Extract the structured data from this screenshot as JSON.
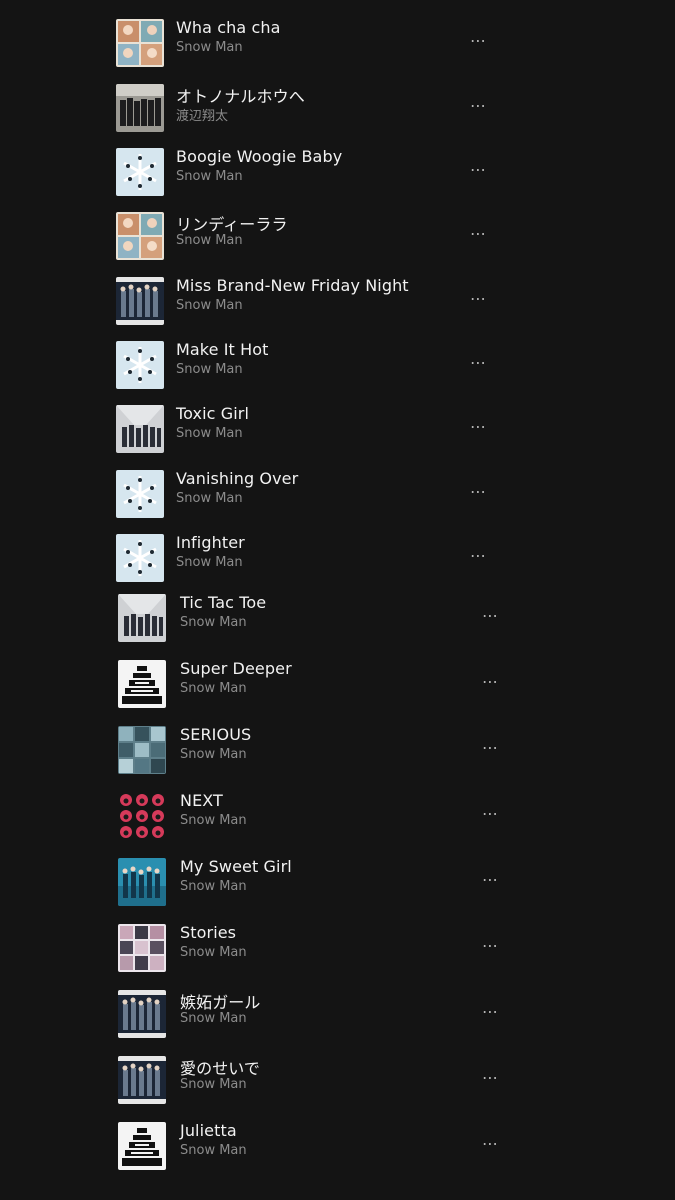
{
  "tracks": [
    {
      "title": "Wha cha cha",
      "artist": "Snow Man",
      "cover": "photo-warm"
    },
    {
      "title": "オトノナルホウへ",
      "artist": "渡辺翔太",
      "cover": "group-dark"
    },
    {
      "title": "Boogie Woogie Baby",
      "artist": "Snow Man",
      "cover": "ice-crystal"
    },
    {
      "title": "リンディーララ",
      "artist": "Snow Man",
      "cover": "photo-warm"
    },
    {
      "title": "Miss Brand-New Friday Night",
      "artist": "Snow Man",
      "cover": "group-navy"
    },
    {
      "title": "Make It Hot",
      "artist": "Snow Man",
      "cover": "ice-crystal"
    },
    {
      "title": "Toxic Girl",
      "artist": "Snow Man",
      "cover": "group-grey"
    },
    {
      "title": "Vanishing Over",
      "artist": "Snow Man",
      "cover": "ice-crystal"
    },
    {
      "title": "Infighter",
      "artist": "Snow Man",
      "cover": "ice-crystal"
    },
    {
      "title": "Tic Tac Toe",
      "artist": "Snow Man",
      "cover": "group-grey"
    },
    {
      "title": "Super Deeper",
      "artist": "Snow Man",
      "cover": "tower-bw"
    },
    {
      "title": "SERIOUS",
      "artist": "Snow Man",
      "cover": "mosaic-teal"
    },
    {
      "title": "NEXT",
      "artist": "Snow Man",
      "cover": "grid-red"
    },
    {
      "title": "My Sweet Girl",
      "artist": "Snow Man",
      "cover": "group-blue"
    },
    {
      "title": "Stories",
      "artist": "Snow Man",
      "cover": "grid-light"
    },
    {
      "title": "嫉妬ガール",
      "artist": "Snow Man",
      "cover": "group-navy"
    },
    {
      "title": "愛のせいで",
      "artist": "Snow Man",
      "cover": "group-navy"
    },
    {
      "title": "Julietta",
      "artist": "Snow Man",
      "cover": "tower-bw"
    }
  ],
  "more_icon": "more-horizontal-icon",
  "more_label": "⋯",
  "colors": {
    "background": "#141414",
    "title": "#f2f2f2",
    "artist": "#8c8c8c",
    "more": "#b5b5b5"
  }
}
